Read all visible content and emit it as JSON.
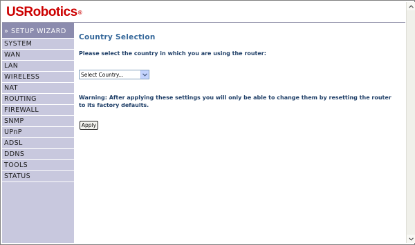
{
  "header": {
    "logo_text": "USRobotics",
    "logo_mark": "®",
    "brand_color": "#cc0000"
  },
  "sidebar": {
    "items": [
      {
        "label": "» SETUP WIZARD",
        "active": true
      },
      {
        "label": "SYSTEM"
      },
      {
        "label": "WAN"
      },
      {
        "label": "LAN"
      },
      {
        "label": "WIRELESS"
      },
      {
        "label": "NAT"
      },
      {
        "label": "ROUTING"
      },
      {
        "label": "FIREWALL"
      },
      {
        "label": "SNMP"
      },
      {
        "label": "UPnP"
      },
      {
        "label": "ADSL"
      },
      {
        "label": "DDNS"
      },
      {
        "label": "TOOLS"
      },
      {
        "label": "STATUS"
      }
    ],
    "background": "#c8c8de",
    "active_background": "#8c8cae"
  },
  "main": {
    "title": "Country Selection",
    "prompt": "Please select the country in which you are using the router:",
    "country_select": {
      "value": "Select Country...",
      "icon": "chevron-down-icon"
    },
    "warning": "Warning: After applying these settings you will only be able to change them by resetting the router to its factory defaults.",
    "apply_label": "Apply",
    "text_color": "#1d3d66",
    "title_color": "#336699"
  },
  "scrollbar": {
    "up_icon": "scroll-up-arrow-icon",
    "down_icon": "scroll-down-arrow-icon"
  }
}
